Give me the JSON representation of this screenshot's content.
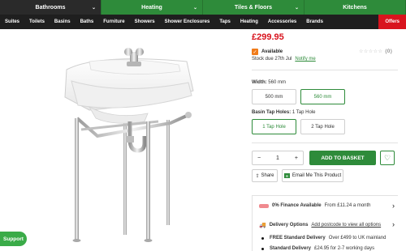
{
  "top_nav": {
    "tabs": [
      {
        "label": "Bathrooms",
        "active": true
      },
      {
        "label": "Heating",
        "active": false
      },
      {
        "label": "Tiles & Floors",
        "active": false
      },
      {
        "label": "Kitchens",
        "active": false
      }
    ]
  },
  "sub_nav": {
    "items": [
      "Suites",
      "Toilets",
      "Basins",
      "Baths",
      "Furniture",
      "Showers",
      "Shower Enclosures",
      "Taps",
      "Heating",
      "Accessories",
      "Brands"
    ],
    "offers_label": "Offers"
  },
  "product": {
    "price": "£299.95",
    "availability": "Available",
    "stock_text": "Stock due 27th Jul",
    "notify_label": "Notify me",
    "rating_count": "(0)"
  },
  "width_option": {
    "label": "Width:",
    "selected": "560 mm",
    "options": [
      "500 mm",
      "560 mm"
    ]
  },
  "tap_option": {
    "label": "Basin Tap Holes:",
    "selected": "1 Tap Hole",
    "options": [
      "1 Tap Hole",
      "2 Tap Hole"
    ]
  },
  "purchase": {
    "minus": "−",
    "quantity": "1",
    "plus": "+",
    "add_label": "ADD TO BASKET",
    "share_label": "Share",
    "email_label": "Email Me This Product"
  },
  "info": {
    "finance_title": "0% Finance Available",
    "finance_text": "From £11.24 a month",
    "delivery_title": "Delivery Options",
    "delivery_link": "Add postcode to view all options",
    "free_title": "FREE Standard Delivery",
    "free_text": "Over £499 to UK mainland",
    "standard_title": "Standard Delivery",
    "standard_text": "£24.95 for 2-7 working days"
  },
  "support_label": "Support",
  "colors": {
    "brand_green": "#2e8b3a",
    "price_red": "#d8141e",
    "offers_red": "#d8141e",
    "check_orange": "#f07b1a"
  }
}
